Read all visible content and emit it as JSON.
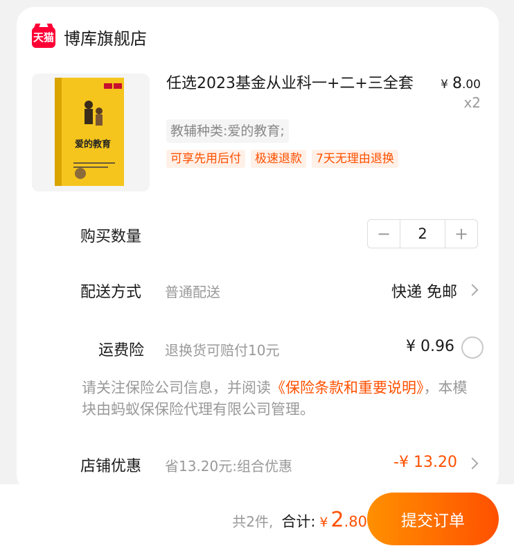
{
  "shop": {
    "logo_text": "天猫",
    "name": "博库旗舰店"
  },
  "product": {
    "title": "任选2023基金从业科一+二+三全套",
    "price_symbol": "¥",
    "price_int": "8",
    "price_dec": ".00",
    "quantity_mult": "x2",
    "sku": "教辅种类:爱的教育;",
    "tags": [
      "可享先用后付",
      "极速退款",
      "7天无理由退换"
    ],
    "image_icon": "book-cover-image",
    "cover_title": "爱的教育"
  },
  "quantity": {
    "label": "购买数量",
    "minus": "−",
    "value": "2",
    "plus": "+"
  },
  "delivery": {
    "label": "配送方式",
    "method": "普通配送",
    "value": "快递 免邮"
  },
  "insurance": {
    "label": "运费险",
    "desc": "退换货可赔付10元",
    "price": "¥ 0.96"
  },
  "notice": {
    "prefix": "请关注保险公司信息，并阅读",
    "link": "《保险条款和重要说明》",
    "suffix": "，本模块由蚂蚁保保险代理有限公司管理。"
  },
  "store_discount": {
    "label": "店铺优惠",
    "desc": "省13.20元:组合优惠",
    "value": "-¥ 13.20"
  },
  "footer": {
    "count": "共2件,",
    "total_label": "合计:",
    "yen": "¥",
    "total_int": "2",
    "total_dec": ".80",
    "submit": "提交订单"
  },
  "colors": {
    "accent": "#ff5000",
    "tmall_red": "#ff0036"
  }
}
